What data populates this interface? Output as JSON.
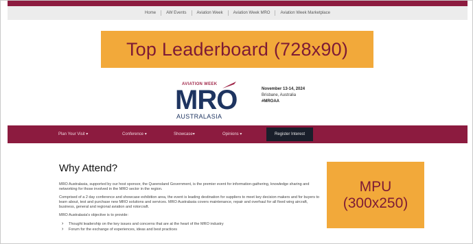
{
  "top_nav": {
    "items": [
      "Home",
      "AW Events",
      "Aviation Week",
      "Aviation Week MRO",
      "Aviation Week Marketplace"
    ]
  },
  "ads": {
    "leaderboard": "Top Leaderboard (728x90)",
    "mpu_line1": "MPU",
    "mpu_line2": "(300x250)"
  },
  "logo": {
    "brand": "AVIATION WEEK",
    "main": "MRO",
    "sub": "AUSTRALASIA"
  },
  "event": {
    "date": "November 13-14, 2024",
    "location": "Brisbane, Australia",
    "hashtag": "#MROAA"
  },
  "main_nav": {
    "items": [
      "Plan Your Visit",
      "Conference",
      "Showcase",
      "Opinions"
    ],
    "register": "Register Interest"
  },
  "content": {
    "heading": "Why Attend?",
    "paragraphs": [
      "MRO Australasia, supported by our host sponsor, the Queensland Government, is the premier event for information-gathering, knowledge sharing and networking for those involved in the MRO sector in the region.",
      "Comprised of a 2 day conference and showcase exhibition area, the event is leading destination for suppliers to meet key decision makers and for buyers to learn about, test and purchase new MRO solutions and services. MRO Australasia covers maintenance, repair and overhaul for all fixed wing aircraft, business, general and regional aviation and rotorcraft.",
      "MRO Australasia's objective is to provide:"
    ],
    "bullets": [
      "Thought leadership on the key issues and concerns that are at the heart of the MRO industry",
      "Forum for the exchange of experiences, ideas and best practices"
    ]
  }
}
